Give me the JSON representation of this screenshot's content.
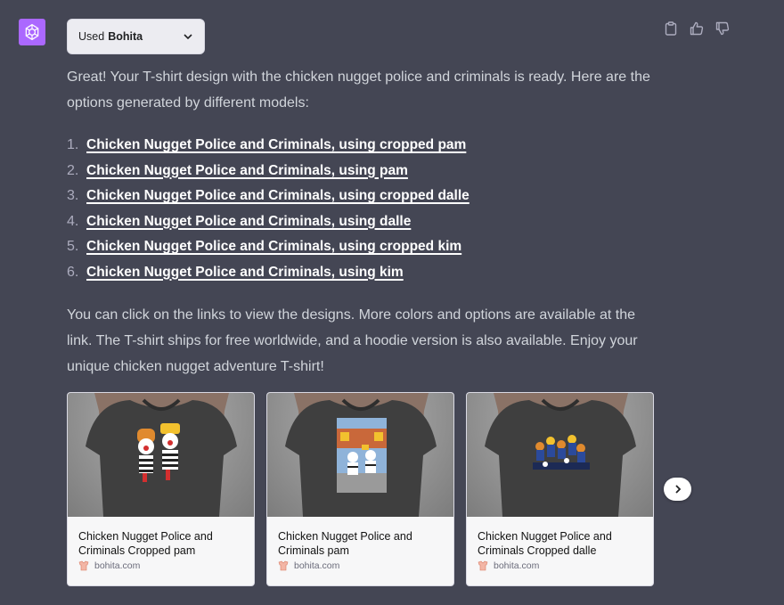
{
  "plugin": {
    "used_label": "Used",
    "plugin_name": "Bohita"
  },
  "message": {
    "intro": "Great! Your T-shirt design with the chicken nugget police and criminals is ready. Here are the options generated by different models:",
    "links": [
      {
        "num": "1.",
        "label": "Chicken Nugget Police and Criminals, using cropped pam"
      },
      {
        "num": "2.",
        "label": "Chicken Nugget Police and Criminals, using pam"
      },
      {
        "num": "3.",
        "label": "Chicken Nugget Police and Criminals, using cropped dalle"
      },
      {
        "num": "4.",
        "label": "Chicken Nugget Police and Criminals, using dalle"
      },
      {
        "num": "5.",
        "label": "Chicken Nugget Police and Criminals, using cropped kim"
      },
      {
        "num": "6.",
        "label": "Chicken Nugget Police and Criminals, using kim"
      }
    ],
    "outro": "You can click on the links to view the designs. More colors and options are available at the link. The T-shirt ships for free worldwide, and a hoodie version is also available. Enjoy your unique chicken nugget adventure T-shirt!"
  },
  "cards": [
    {
      "title": "Chicken Nugget Police and Criminals Cropped pam",
      "source": "bohita.com"
    },
    {
      "title": "Chicken Nugget Police and Criminals  pam",
      "source": "bohita.com"
    },
    {
      "title": "Chicken Nugget Police and Criminals Cropped dalle",
      "source": "bohita.com"
    }
  ],
  "colors": {
    "background": "#444654",
    "avatar": "#ab68ff",
    "link": "#ffffff",
    "text": "#d1d5db"
  },
  "icons": [
    "openai-logo-icon",
    "chevron-down-icon",
    "clipboard-icon",
    "thumbs-up-icon",
    "thumbs-down-icon",
    "chevron-right-icon",
    "bohita-favicon-icon"
  ]
}
